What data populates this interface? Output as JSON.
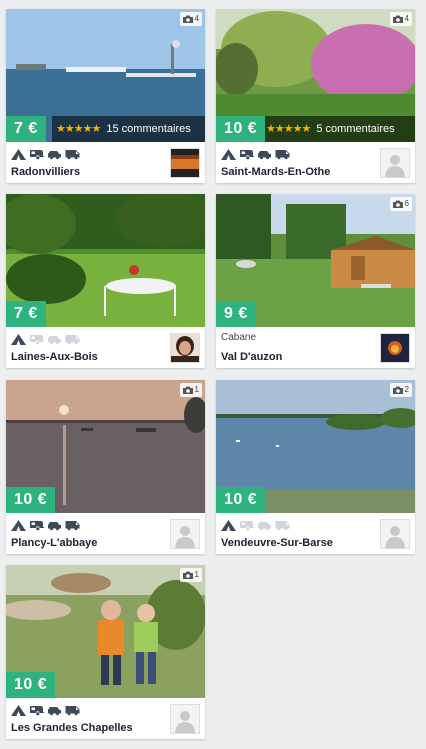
{
  "listings": [
    {
      "price": "7 €",
      "rating_stars": "★★★★★",
      "rating_text": "15 commentaires",
      "photo_count": "4",
      "name": "Radonvilliers",
      "subtype": "",
      "avatar": "photo-avatar"
    },
    {
      "price": "10 €",
      "rating_stars": "★★★★★",
      "rating_text": "5 commentaires",
      "photo_count": "4",
      "name": "Saint-Mards-En-Othe",
      "subtype": "",
      "avatar": "placeholder-avatar"
    },
    {
      "price": "7 €",
      "rating_stars": "",
      "rating_text": "",
      "photo_count": "",
      "name": "Laines-Aux-Bois",
      "subtype": "",
      "avatar": "photo-avatar"
    },
    {
      "price": "9 €",
      "rating_stars": "",
      "rating_text": "",
      "photo_count": "6",
      "name": "Val D'auzon",
      "subtype": "Cabane",
      "avatar": "photo-avatar"
    },
    {
      "price": "10 €",
      "rating_stars": "",
      "rating_text": "",
      "photo_count": "1",
      "name": "Plancy-L'abbaye",
      "subtype": "",
      "avatar": "placeholder-avatar"
    },
    {
      "price": "10 €",
      "rating_stars": "",
      "rating_text": "",
      "photo_count": "2",
      "name": "Vendeuvre-Sur-Barse",
      "subtype": "",
      "avatar": "placeholder-avatar"
    },
    {
      "price": "10 €",
      "rating_stars": "",
      "rating_text": "",
      "photo_count": "1",
      "name": "Les Grandes Chapelles",
      "subtype": "",
      "avatar": "placeholder-avatar"
    }
  ],
  "accommodation_icons": [
    "tent-icon",
    "caravan-icon",
    "car-icon",
    "campervan-icon"
  ],
  "colors": {
    "price_badge": "#2fb37e",
    "star": "#f4b400",
    "icon_on": "#3d4a5a",
    "icon_off": "#d0d5db",
    "background": "#eceef0"
  }
}
